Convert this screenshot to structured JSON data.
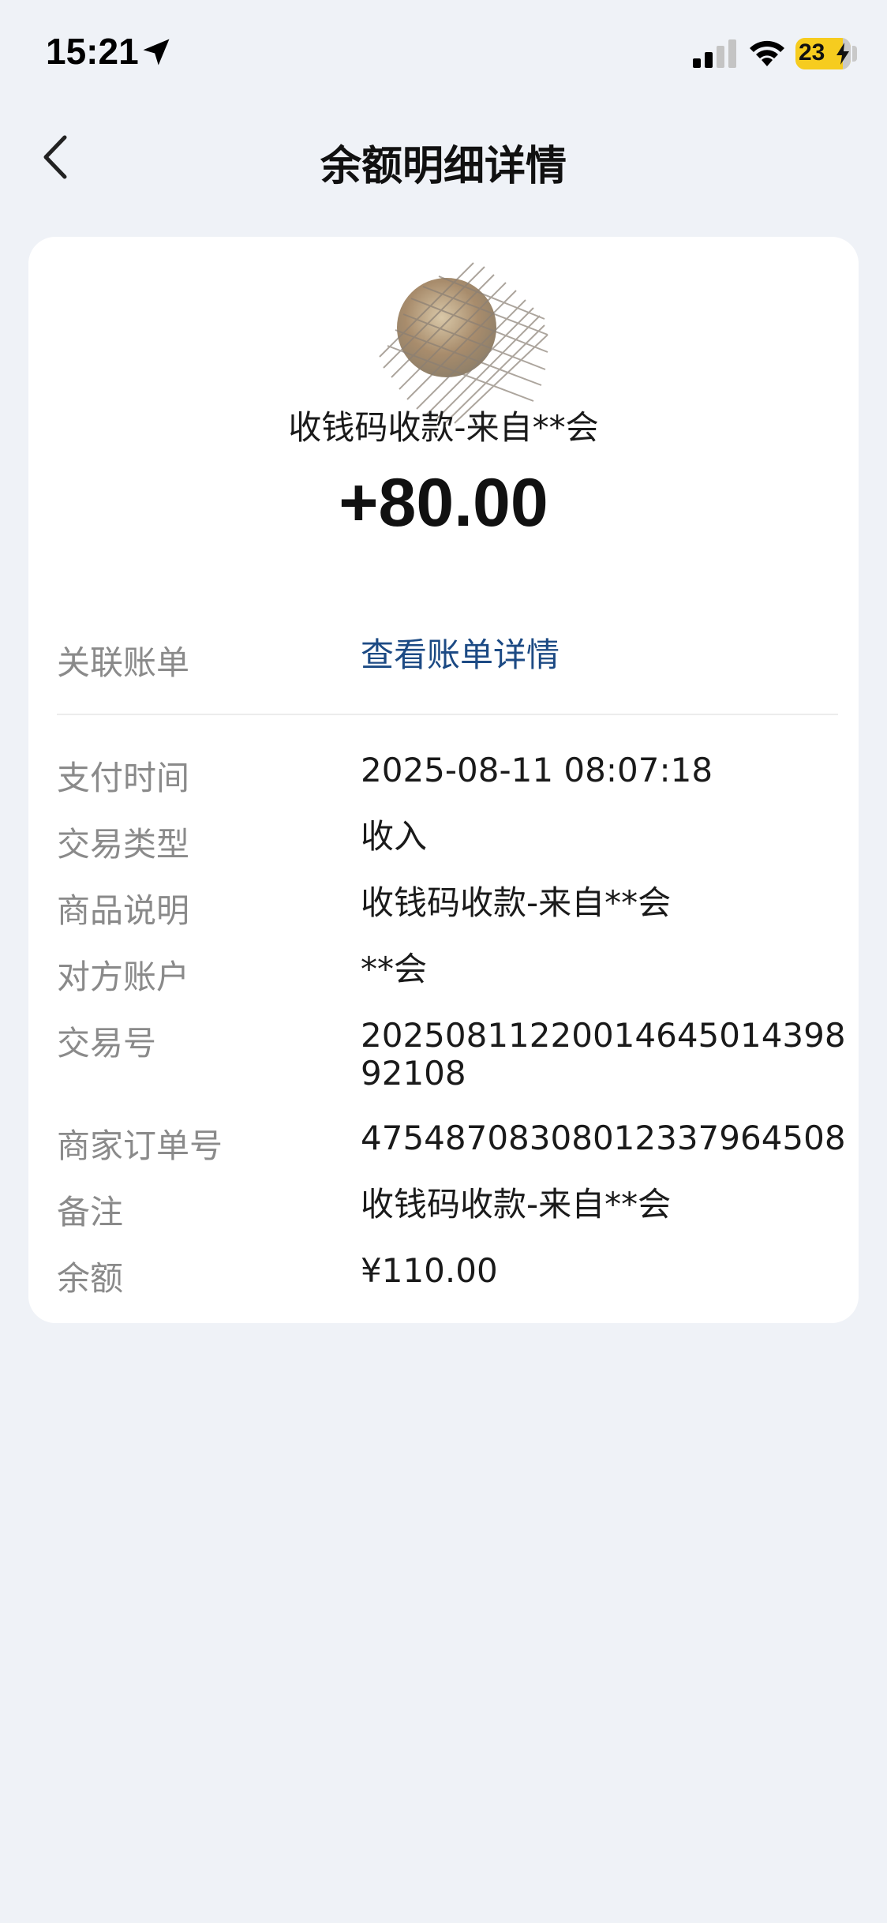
{
  "status_bar": {
    "time": "15:21",
    "battery": "23"
  },
  "header": {
    "title": "余额明细详情"
  },
  "transaction": {
    "counterparty_title": "收钱码收款-来自**会",
    "amount": "+80.00"
  },
  "related_bill": {
    "label": "关联账单",
    "link_text": "查看账单详情"
  },
  "details": [
    {
      "label": "支付时间",
      "value": "2025-08-11 08:07:18"
    },
    {
      "label": "交易类型",
      "value": "收入"
    },
    {
      "label": "商品说明",
      "value": "收钱码收款-来自**会"
    },
    {
      "label": "对方账户",
      "value": "**会"
    },
    {
      "label": "交易号",
      "value": "2025081122001464501439892108"
    },
    {
      "label": "商家订单号",
      "value": "47548708308012337964508"
    },
    {
      "label": "备注",
      "value": "收钱码收款-来自**会"
    },
    {
      "label": "余额",
      "value": "¥110.00"
    }
  ],
  "colors": {
    "background": "#eff2f7",
    "card": "#ffffff",
    "link": "#1c4a84",
    "label": "#8a8a8a",
    "battery": "#f6cc1f"
  },
  "icons": [
    "location-arrow-icon",
    "signal-icon",
    "wifi-icon",
    "battery-icon",
    "back-chevron-icon"
  ]
}
